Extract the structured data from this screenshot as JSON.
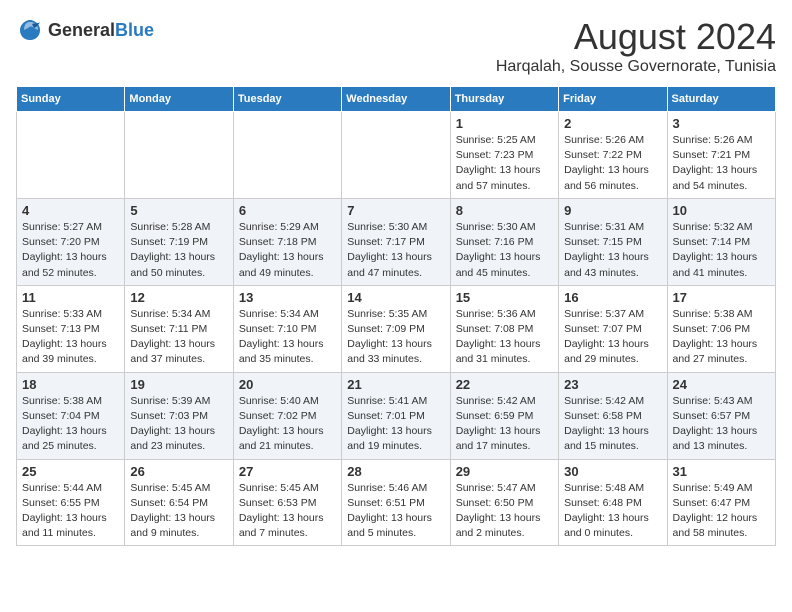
{
  "header": {
    "logo_general": "General",
    "logo_blue": "Blue",
    "month_title": "August 2024",
    "location": "Harqalah, Sousse Governorate, Tunisia"
  },
  "days_of_week": [
    "Sunday",
    "Monday",
    "Tuesday",
    "Wednesday",
    "Thursday",
    "Friday",
    "Saturday"
  ],
  "weeks": [
    [
      {
        "day": "",
        "info": ""
      },
      {
        "day": "",
        "info": ""
      },
      {
        "day": "",
        "info": ""
      },
      {
        "day": "",
        "info": ""
      },
      {
        "day": "1",
        "info": "Sunrise: 5:25 AM\nSunset: 7:23 PM\nDaylight: 13 hours\nand 57 minutes."
      },
      {
        "day": "2",
        "info": "Sunrise: 5:26 AM\nSunset: 7:22 PM\nDaylight: 13 hours\nand 56 minutes."
      },
      {
        "day": "3",
        "info": "Sunrise: 5:26 AM\nSunset: 7:21 PM\nDaylight: 13 hours\nand 54 minutes."
      }
    ],
    [
      {
        "day": "4",
        "info": "Sunrise: 5:27 AM\nSunset: 7:20 PM\nDaylight: 13 hours\nand 52 minutes."
      },
      {
        "day": "5",
        "info": "Sunrise: 5:28 AM\nSunset: 7:19 PM\nDaylight: 13 hours\nand 50 minutes."
      },
      {
        "day": "6",
        "info": "Sunrise: 5:29 AM\nSunset: 7:18 PM\nDaylight: 13 hours\nand 49 minutes."
      },
      {
        "day": "7",
        "info": "Sunrise: 5:30 AM\nSunset: 7:17 PM\nDaylight: 13 hours\nand 47 minutes."
      },
      {
        "day": "8",
        "info": "Sunrise: 5:30 AM\nSunset: 7:16 PM\nDaylight: 13 hours\nand 45 minutes."
      },
      {
        "day": "9",
        "info": "Sunrise: 5:31 AM\nSunset: 7:15 PM\nDaylight: 13 hours\nand 43 minutes."
      },
      {
        "day": "10",
        "info": "Sunrise: 5:32 AM\nSunset: 7:14 PM\nDaylight: 13 hours\nand 41 minutes."
      }
    ],
    [
      {
        "day": "11",
        "info": "Sunrise: 5:33 AM\nSunset: 7:13 PM\nDaylight: 13 hours\nand 39 minutes."
      },
      {
        "day": "12",
        "info": "Sunrise: 5:34 AM\nSunset: 7:11 PM\nDaylight: 13 hours\nand 37 minutes."
      },
      {
        "day": "13",
        "info": "Sunrise: 5:34 AM\nSunset: 7:10 PM\nDaylight: 13 hours\nand 35 minutes."
      },
      {
        "day": "14",
        "info": "Sunrise: 5:35 AM\nSunset: 7:09 PM\nDaylight: 13 hours\nand 33 minutes."
      },
      {
        "day": "15",
        "info": "Sunrise: 5:36 AM\nSunset: 7:08 PM\nDaylight: 13 hours\nand 31 minutes."
      },
      {
        "day": "16",
        "info": "Sunrise: 5:37 AM\nSunset: 7:07 PM\nDaylight: 13 hours\nand 29 minutes."
      },
      {
        "day": "17",
        "info": "Sunrise: 5:38 AM\nSunset: 7:06 PM\nDaylight: 13 hours\nand 27 minutes."
      }
    ],
    [
      {
        "day": "18",
        "info": "Sunrise: 5:38 AM\nSunset: 7:04 PM\nDaylight: 13 hours\nand 25 minutes."
      },
      {
        "day": "19",
        "info": "Sunrise: 5:39 AM\nSunset: 7:03 PM\nDaylight: 13 hours\nand 23 minutes."
      },
      {
        "day": "20",
        "info": "Sunrise: 5:40 AM\nSunset: 7:02 PM\nDaylight: 13 hours\nand 21 minutes."
      },
      {
        "day": "21",
        "info": "Sunrise: 5:41 AM\nSunset: 7:01 PM\nDaylight: 13 hours\nand 19 minutes."
      },
      {
        "day": "22",
        "info": "Sunrise: 5:42 AM\nSunset: 6:59 PM\nDaylight: 13 hours\nand 17 minutes."
      },
      {
        "day": "23",
        "info": "Sunrise: 5:42 AM\nSunset: 6:58 PM\nDaylight: 13 hours\nand 15 minutes."
      },
      {
        "day": "24",
        "info": "Sunrise: 5:43 AM\nSunset: 6:57 PM\nDaylight: 13 hours\nand 13 minutes."
      }
    ],
    [
      {
        "day": "25",
        "info": "Sunrise: 5:44 AM\nSunset: 6:55 PM\nDaylight: 13 hours\nand 11 minutes."
      },
      {
        "day": "26",
        "info": "Sunrise: 5:45 AM\nSunset: 6:54 PM\nDaylight: 13 hours\nand 9 minutes."
      },
      {
        "day": "27",
        "info": "Sunrise: 5:45 AM\nSunset: 6:53 PM\nDaylight: 13 hours\nand 7 minutes."
      },
      {
        "day": "28",
        "info": "Sunrise: 5:46 AM\nSunset: 6:51 PM\nDaylight: 13 hours\nand 5 minutes."
      },
      {
        "day": "29",
        "info": "Sunrise: 5:47 AM\nSunset: 6:50 PM\nDaylight: 13 hours\nand 2 minutes."
      },
      {
        "day": "30",
        "info": "Sunrise: 5:48 AM\nSunset: 6:48 PM\nDaylight: 13 hours\nand 0 minutes."
      },
      {
        "day": "31",
        "info": "Sunrise: 5:49 AM\nSunset: 6:47 PM\nDaylight: 12 hours\nand 58 minutes."
      }
    ]
  ]
}
